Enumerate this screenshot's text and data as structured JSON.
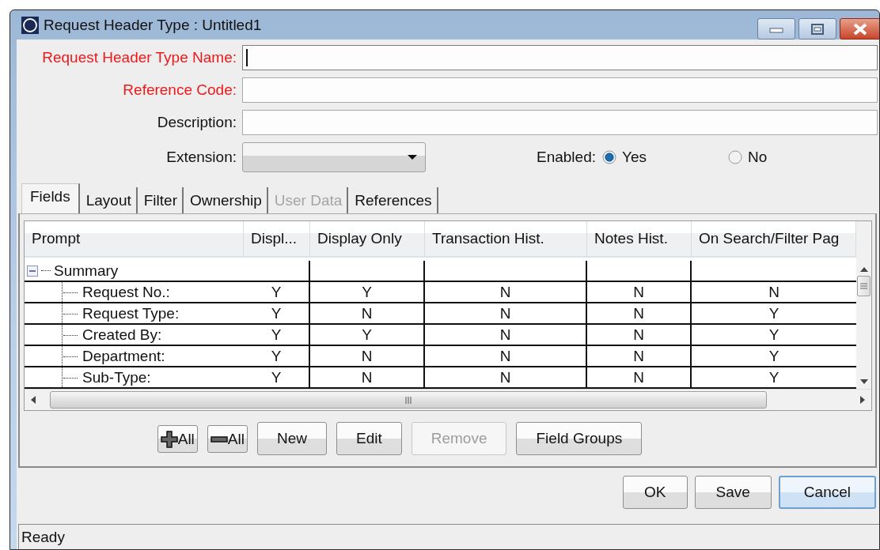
{
  "window": {
    "title": "Request Header Type : Untitled1"
  },
  "form": {
    "fields": [
      {
        "label": "Request Header Type Name:",
        "required": true,
        "kind": "text",
        "focused": true
      },
      {
        "label": "Reference Code:",
        "required": true,
        "kind": "text",
        "focused": false
      },
      {
        "label": "Description:",
        "required": false,
        "kind": "text",
        "focused": false
      },
      {
        "label": "Extension:",
        "required": false,
        "kind": "combo",
        "focused": false
      }
    ],
    "enabled": {
      "label": "Enabled:",
      "options": [
        {
          "label": "Yes",
          "selected": true
        },
        {
          "label": "No",
          "selected": false
        }
      ]
    }
  },
  "tabs": [
    {
      "label": "Fields",
      "selected": true,
      "disabled": false
    },
    {
      "label": "Layout",
      "selected": false,
      "disabled": false
    },
    {
      "label": "Filter",
      "selected": false,
      "disabled": false
    },
    {
      "label": "Ownership",
      "selected": false,
      "disabled": false
    },
    {
      "label": "User Data",
      "selected": false,
      "disabled": true
    },
    {
      "label": "References",
      "selected": false,
      "disabled": false
    }
  ],
  "table": {
    "columns": [
      "Prompt",
      "Displ...",
      "Display Only",
      "Transaction Hist.",
      "Notes Hist.",
      "On Search/Filter Pag"
    ],
    "rows": [
      {
        "prompt": "Summary",
        "expanded": true,
        "children": [
          {
            "prompt": "Request No.:",
            "cells": [
              "Y",
              "Y",
              "N",
              "N",
              "N"
            ]
          },
          {
            "prompt": "Request Type:",
            "cells": [
              "Y",
              "N",
              "N",
              "N",
              "Y"
            ]
          },
          {
            "prompt": "Created By:",
            "cells": [
              "Y",
              "Y",
              "N",
              "N",
              "Y"
            ]
          },
          {
            "prompt": "Department:",
            "cells": [
              "Y",
              "N",
              "N",
              "N",
              "Y"
            ]
          },
          {
            "prompt": "Sub-Type:",
            "cells": [
              "Y",
              "N",
              "N",
              "N",
              "Y"
            ]
          }
        ]
      }
    ]
  },
  "panel_buttons": [
    {
      "label": "All",
      "kind": "expand-all",
      "disabled": false
    },
    {
      "label": "All",
      "kind": "collapse-all",
      "disabled": false
    },
    {
      "label": "New",
      "kind": "text",
      "disabled": false
    },
    {
      "label": "Edit",
      "kind": "text",
      "disabled": false
    },
    {
      "label": "Remove",
      "kind": "text",
      "disabled": true
    },
    {
      "label": "Field Groups",
      "kind": "text",
      "disabled": false
    }
  ],
  "dialog_buttons": [
    {
      "label": "OK",
      "focused": false
    },
    {
      "label": "Save",
      "focused": false
    },
    {
      "label": "Cancel",
      "focused": true
    }
  ],
  "status_bar": "Ready"
}
